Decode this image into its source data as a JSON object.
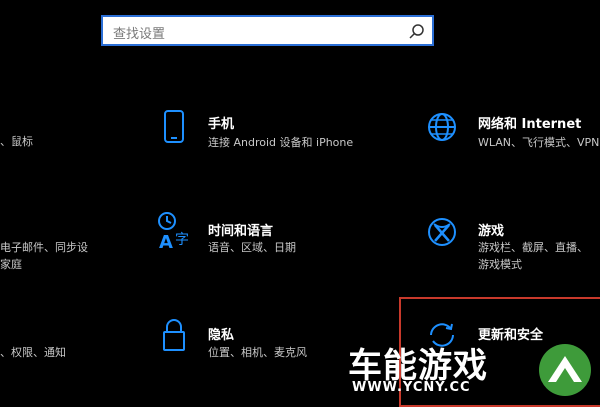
{
  "search": {
    "placeholder": "查找设置"
  },
  "left_cut": [
    {
      "sub": "、鼠标"
    },
    {
      "sub": "电子邮件、同步设",
      "sub2": "家庭"
    },
    {
      "sub": "、权限、通知"
    }
  ],
  "tiles": [
    {
      "title": "手机",
      "sub": "连接 Android 设备和 iPhone",
      "icon": "phone-icon"
    },
    {
      "title": "网络和 Internet",
      "sub": "WLAN、飞行模式、VPN",
      "icon": "globe-icon"
    },
    {
      "title": "时间和语言",
      "sub": "语音、区域、日期",
      "icon": "time-language-icon"
    },
    {
      "title": "游戏",
      "sub": "游戏栏、截屏、直播、",
      "sub2": "游戏模式",
      "icon": "xbox-icon"
    },
    {
      "title": "隐私",
      "sub": "位置、相机、麦克风",
      "icon": "lock-icon"
    },
    {
      "title": "更新和安全",
      "icon": "sync-icon"
    }
  ],
  "watermark": {
    "name": "车能游戏",
    "url": "WWW.YCNY.CC"
  },
  "colors": {
    "accent": "#1e90ff",
    "highlight": "#c8392b",
    "watermark_green": "#3e9b3a"
  }
}
